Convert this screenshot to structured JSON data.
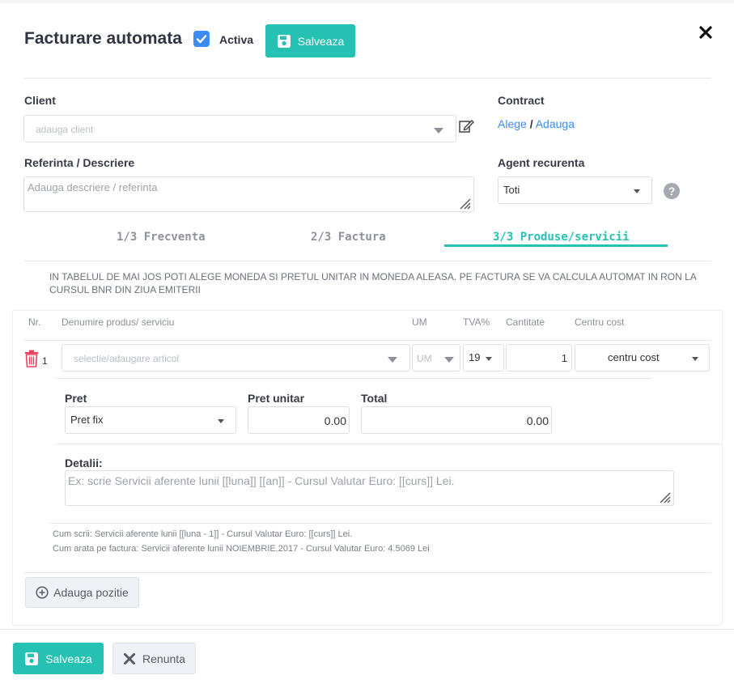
{
  "header": {
    "title": "Facturare automata",
    "active_label": "Activa",
    "active_checked": true,
    "save_label": "Salveaza"
  },
  "client": {
    "label": "Client",
    "placeholder": "adauga client"
  },
  "contract": {
    "label": "Contract",
    "choose_link": "Alege",
    "separator": "/",
    "add_link": "Adauga"
  },
  "reference": {
    "label": "Referinta / Descriere",
    "placeholder": "Adauga descriere / referinta"
  },
  "agent": {
    "label": "Agent recurenta",
    "value": "Toti"
  },
  "tabs": [
    {
      "label": "1/3 Frecventa"
    },
    {
      "label": "2/3 Factura"
    },
    {
      "label": "3/3 Produse/servicii"
    }
  ],
  "info_text": "IN TABELUL DE MAI JOS POTI ALEGE MONEDA SI PRETUL UNITAR IN MONEDA ALEASA. PE FACTURA SE VA CALCULA AUTOMAT IN RON LA CURSUL BNR DIN ZIUA EMITERII",
  "table": {
    "headers": [
      "Nr.",
      "Denumire produs/ serviciu",
      "UM",
      "TVA%",
      "Cantitate",
      "Centru cost"
    ],
    "row": {
      "nr": "1",
      "product_placeholder": "selectie/adaugare articol",
      "um_placeholder": "UM",
      "tva": "19",
      "quantity": "1",
      "cost_center": "centru cost"
    }
  },
  "pricing": {
    "pret_label": "Pret",
    "pret_value": "Pret fix",
    "unit_label": "Pret unitar",
    "unit_value": "0.00",
    "total_label": "Total",
    "total_value": "0.00"
  },
  "details": {
    "label": "Detalii:",
    "placeholder": "Ex: scrie Servicii aferente lunii [[luna]] [[an]] - Cursul Valutar Euro: [[curs]] Lei.",
    "help_line1": "Cum scrii: Servicii aferente lunii [[luna - 1]] - Cursul Valutar Euro: [[curs]] Lei.",
    "help_line2": "Cum arata pe factura: Servicii aferente lunii NOIEMBRIE.2017 - Cursul Valutar Euro: 4.5069 Lei"
  },
  "add_position_label": "Adauga pozitie",
  "footer": {
    "save_label": "Salveaza",
    "cancel_label": "Renunta"
  },
  "colors": {
    "accent": "#25c2b3",
    "link": "#3b8bf2",
    "danger": "#e8415a"
  }
}
